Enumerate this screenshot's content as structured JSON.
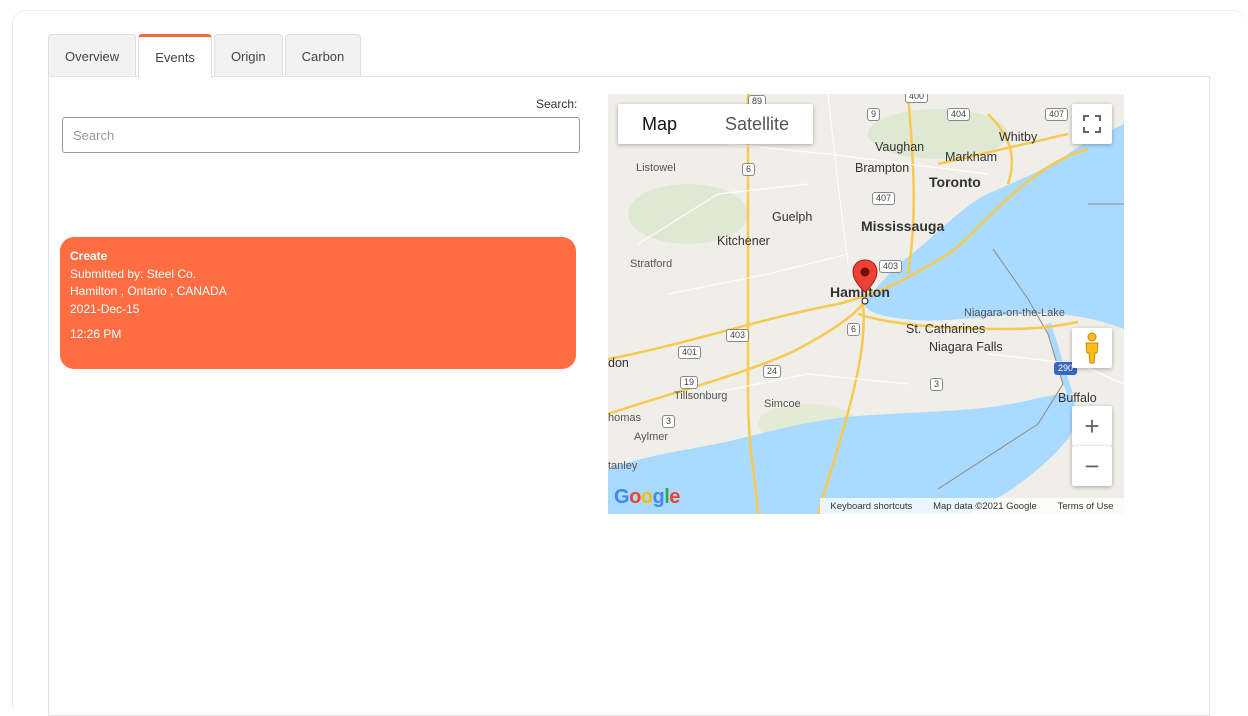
{
  "tabs": [
    {
      "label": "Overview",
      "active": false
    },
    {
      "label": "Events",
      "active": true
    },
    {
      "label": "Origin",
      "active": false
    },
    {
      "label": "Carbon",
      "active": false
    }
  ],
  "search": {
    "label": "Search:",
    "placeholder": "Search"
  },
  "event": {
    "type": "Create",
    "submitted_by": "Submitted by: Steel Co.",
    "location": "Hamilton , Ontario , CANADA",
    "date": "2021-Dec-15",
    "time": "12:26 PM"
  },
  "map": {
    "type_control": {
      "map_label": "Map",
      "satellite_label": "Satellite",
      "selected": "Map"
    },
    "places": {
      "hamilton": "Hamilton",
      "toronto": "Toronto",
      "mississauga": "Mississauga",
      "brampton": "Brampton",
      "vaughan": "Vaughan",
      "markham": "Markham",
      "whitby": "Whitby",
      "guelph": "Guelph",
      "kitchener": "Kitchener",
      "stratford": "Stratford",
      "listowel": "Listowel",
      "st_catharines": "St. Catharines",
      "niagara_falls": "Niagara Falls",
      "niagara_on_the_lake": "Niagara-on-the-Lake",
      "buffalo": "Buffalo",
      "tillsonburg": "Tillsonburg",
      "simcoe": "Simcoe",
      "aylmer": "Aylmer",
      "london_partial": "don",
      "thomas_partial": "homas",
      "stanley_partial": "tanley"
    },
    "shields": [
      "89",
      "400",
      "9",
      "404",
      "407",
      "6",
      "407",
      "403",
      "403",
      "6",
      "401",
      "19",
      "24",
      "3",
      "3",
      "290"
    ],
    "google_logo": "Google",
    "footer": {
      "shortcuts": "Keyboard shortcuts",
      "data": "Map data ©2021 Google",
      "terms": "Terms of Use"
    },
    "zoom_in": "+",
    "zoom_out": "−",
    "colors": {
      "water": "#aadaff",
      "land": "#f0eee8",
      "road": "#f9c94e",
      "marker": "#ea4335",
      "accent": "#ff6d42"
    }
  }
}
